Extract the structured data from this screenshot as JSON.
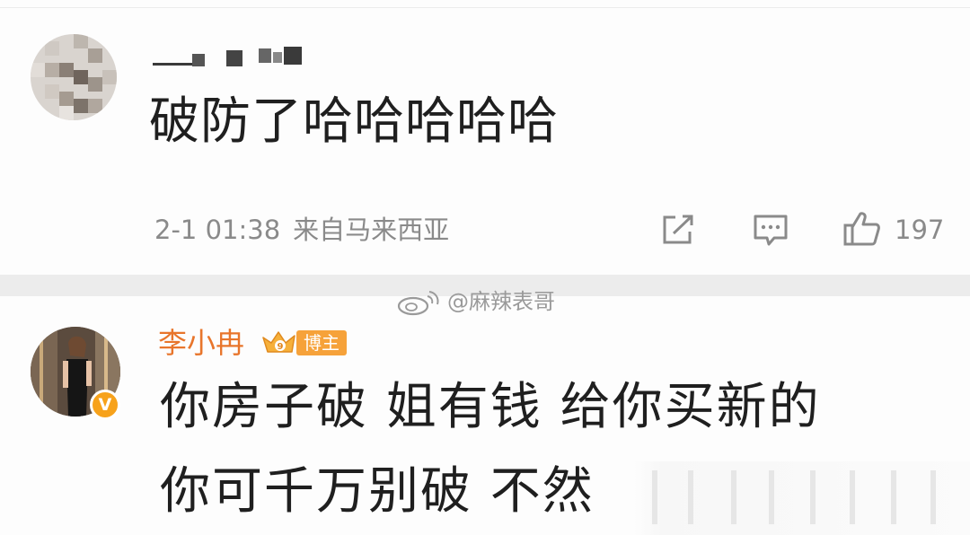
{
  "comment1": {
    "text": "破防了哈哈哈哈哈",
    "time": "2-1 01:38",
    "location": "来自马来西亚",
    "likes": "197",
    "icons": [
      "share-icon",
      "comment-icon",
      "like-icon"
    ]
  },
  "watermark": {
    "text": "@麻辣表哥",
    "icon": "weibo-logo-icon"
  },
  "comment2": {
    "username": "李小冉",
    "badge": "博主",
    "line1": "你房子破 姐有钱 给你买新的",
    "line2": "你可千万别破 不然",
    "verified_mark": "V"
  },
  "colors": {
    "username_orange": "#e8752b",
    "badge_orange": "#f6a23a",
    "meta_gray": "#8a8a8a",
    "text_dark": "#1f1f1f",
    "separator": "#ececec"
  }
}
